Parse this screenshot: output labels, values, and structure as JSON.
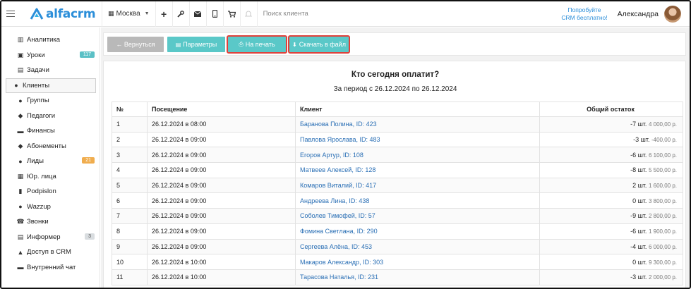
{
  "topbar": {
    "logo_text": "alfacrm",
    "branch": "Москва",
    "icons": [
      "plus-icon",
      "wrench-icon",
      "mail-icon",
      "phone-icon",
      "cart-icon",
      "bell-icon"
    ],
    "search_placeholder": "Поиск клиента",
    "try_line1": "Попробуйте",
    "try_line2": "CRM бесплатно!",
    "user_name": "Александра"
  },
  "sidebar": {
    "items": [
      {
        "label": "Аналитика",
        "icon": "chart-icon",
        "glyph": "▥"
      },
      {
        "label": "Уроки",
        "icon": "calendar-icon",
        "glyph": "▣",
        "badge": "117",
        "badge_color": "#5bc0c6"
      },
      {
        "label": "Задачи",
        "icon": "tasks-icon",
        "glyph": "▤"
      },
      {
        "label": "Клиенты",
        "icon": "user-icon",
        "glyph": "●",
        "active": true
      },
      {
        "label": "Группы",
        "icon": "users-icon",
        "glyph": "●"
      },
      {
        "label": "Педагоги",
        "icon": "teacher-icon",
        "glyph": "◆"
      },
      {
        "label": "Финансы",
        "icon": "money-icon",
        "glyph": "▬"
      },
      {
        "label": "Абонементы",
        "icon": "tag-icon",
        "glyph": "◆"
      },
      {
        "label": "Лиды",
        "icon": "lead-icon",
        "glyph": "●",
        "badge": "21",
        "badge_color": "#f0ad4e"
      },
      {
        "label": "Юр. лица",
        "icon": "building-icon",
        "glyph": "▦"
      },
      {
        "label": "Podpislon",
        "icon": "file-icon",
        "glyph": "▮"
      },
      {
        "label": "Wazzup",
        "icon": "whatsapp-icon",
        "glyph": "●"
      },
      {
        "label": "Звонки",
        "icon": "phone-call-icon",
        "glyph": "☎"
      },
      {
        "label": "Информер",
        "icon": "informer-icon",
        "glyph": "▤",
        "badge": "3",
        "badge_color": "#d9dde0"
      },
      {
        "label": "Доступ в CRM",
        "icon": "lock-icon",
        "glyph": "▲"
      },
      {
        "label": "Внутренний чат",
        "icon": "chat-icon",
        "glyph": "▬"
      }
    ]
  },
  "toolbar": {
    "back_label": "← Вернуться",
    "params_label": "Параметры",
    "print_label": "На печать",
    "download_label": "Скачать в файл"
  },
  "report": {
    "title": "Кто сегодня оплатит?",
    "subtitle": "За период с 26.12.2024 по 26.12.2024",
    "columns": [
      "№",
      "Посещение",
      "Клиент",
      "Общий остаток"
    ],
    "rows": [
      {
        "no": "1",
        "visit": "26.12.2024 в 08:00",
        "client": "Баранова Полина, ID: 423",
        "qty": "-7 шт.",
        "money": "4 000,00 р."
      },
      {
        "no": "2",
        "visit": "26.12.2024 в 09:00",
        "client": "Павлова Ярослава, ID: 483",
        "qty": "-3 шт.",
        "money": "-400,00 р."
      },
      {
        "no": "3",
        "visit": "26.12.2024 в 09:00",
        "client": "Егоров Артур, ID: 108",
        "qty": "-6 шт.",
        "money": "6 100,00 р."
      },
      {
        "no": "4",
        "visit": "26.12.2024 в 09:00",
        "client": "Матвеев Алексей, ID: 128",
        "qty": "-8 шт.",
        "money": "5 500,00 р."
      },
      {
        "no": "5",
        "visit": "26.12.2024 в 09:00",
        "client": "Комаров Виталий, ID: 417",
        "qty": "2 шт.",
        "money": "1 600,00 р."
      },
      {
        "no": "6",
        "visit": "26.12.2024 в 09:00",
        "client": "Андреева Лина, ID: 438",
        "qty": "0 шт.",
        "money": "3 800,00 р."
      },
      {
        "no": "7",
        "visit": "26.12.2024 в 09:00",
        "client": "Соболев Тимофей, ID: 57",
        "qty": "-9 шт.",
        "money": "2 800,00 р."
      },
      {
        "no": "8",
        "visit": "26.12.2024 в 09:00",
        "client": "Фомина Светлана, ID: 290",
        "qty": "-6 шт.",
        "money": "1 900,00 р."
      },
      {
        "no": "9",
        "visit": "26.12.2024 в 09:00",
        "client": "Сергеева Алёна, ID: 453",
        "qty": "-4 шт.",
        "money": "6 000,00 р."
      },
      {
        "no": "10",
        "visit": "26.12.2024 в 10:00",
        "client": "Макаров Александр, ID: 303",
        "qty": "0 шт.",
        "money": "9 300,00 р."
      },
      {
        "no": "11",
        "visit": "26.12.2024 в 10:00",
        "client": "Тарасова Наталья, ID: 231",
        "qty": "-3 шт.",
        "money": "2 000,00 р."
      }
    ]
  },
  "colors": {
    "brand": "#2b8ed9",
    "teal_button": "#5ac8c8",
    "highlight": "#e0403a",
    "link": "#2a6fb5"
  }
}
